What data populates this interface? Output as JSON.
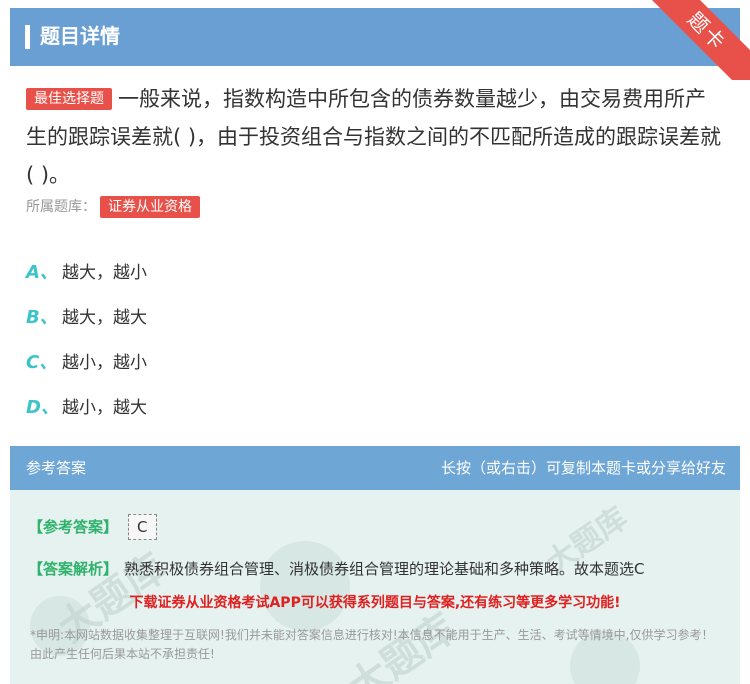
{
  "header": {
    "title": "题目详情"
  },
  "ribbon": {
    "label": "题卡"
  },
  "question": {
    "tag": "最佳选择题",
    "text": "一般来说，指数构造中所包含的债券数量越少，由交易费用所产生的跟踪误差就( )，由于投资组合与指数之间的不匹配所造成的跟踪误差就( )。"
  },
  "source": {
    "label": "所属题库：",
    "tag": "证券从业资格"
  },
  "options": [
    {
      "letter": "A、",
      "text": "越大，越小"
    },
    {
      "letter": "B、",
      "text": "越大，越大"
    },
    {
      "letter": "C、",
      "text": "越小，越小"
    },
    {
      "letter": "D、",
      "text": "越小，越大"
    }
  ],
  "answer": {
    "section_title": "参考答案",
    "share_hint": "长按（或右击）可复制本题卡或分享给好友",
    "answer_label": "【参考答案】",
    "answer_value": "C",
    "analysis_label": "【答案解析】",
    "analysis_text": "熟悉积极债券组合管理、消极债券组合管理的理论基础和多种策略。故本题选C",
    "promo": "下载证券从业资格考试APP可以获得系列题目与答案,还有练习等更多学习功能!",
    "disclaimer": "*申明:本网站数据收集整理于互联网!我们并未能对答案信息进行核对!本信息不能用于生产、生活、考试等情境中,仅供学习参考！由此产生任何后果本站不承担责任!"
  },
  "watermark": {
    "text": "www.statiku.com",
    "brand": "大题库"
  }
}
